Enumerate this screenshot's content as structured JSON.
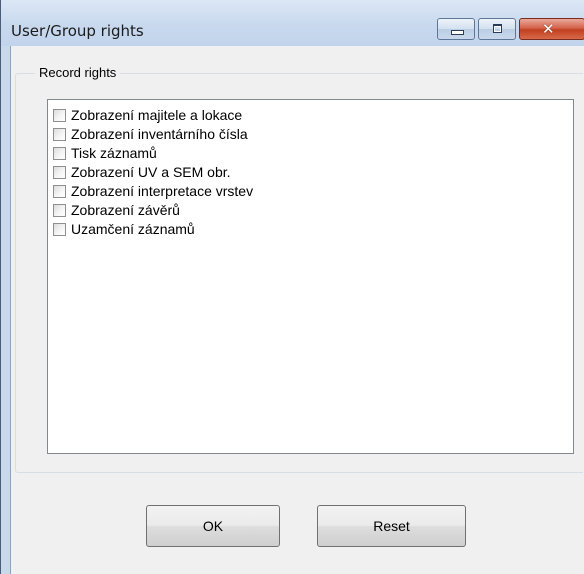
{
  "window": {
    "title": "User/Group rights",
    "controls": {
      "minimize_icon": "minimize-icon",
      "maximize_icon": "maximize-icon",
      "close_icon": "close-icon",
      "close_glyph": "✕"
    }
  },
  "group": {
    "legend": "Record rights",
    "items": [
      {
        "label": "Zobrazení majitele a lokace",
        "checked": false
      },
      {
        "label": "Zobrazení inventárního čísla",
        "checked": false
      },
      {
        "label": "Tisk záznamů",
        "checked": false
      },
      {
        "label": "Zobrazení UV a SEM obr.",
        "checked": false
      },
      {
        "label": "Zobrazení interpretace vrstev",
        "checked": false
      },
      {
        "label": "Zobrazení závěrů",
        "checked": false
      },
      {
        "label": "Uzamčení záznamů",
        "checked": false
      }
    ]
  },
  "buttons": {
    "ok_label": "OK",
    "reset_label": "Reset"
  },
  "colors": {
    "titlebar": "#c8d9ee",
    "close_button": "#c2401f",
    "client_background": "#f0f0f0",
    "list_background": "#ffffff"
  }
}
